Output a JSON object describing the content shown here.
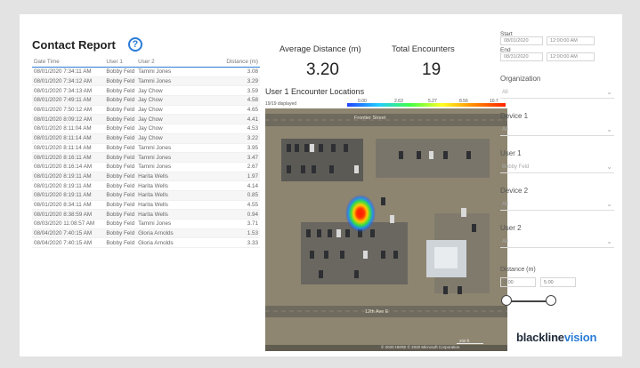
{
  "report": {
    "title": "Contact Report",
    "help_symbol": "?",
    "columns": [
      "Date Time",
      "User 1",
      "User 2",
      "Distance (m)"
    ],
    "rows": [
      [
        "08/01/2020 7:34:11 AM",
        "Bobby Feld",
        "Tammi Jones",
        "3.08"
      ],
      [
        "08/01/2020 7:34:12 AM",
        "Bobby Feld",
        "Tammi Jones",
        "3.29"
      ],
      [
        "08/01/2020 7:34:13 AM",
        "Bobby Feld",
        "Jay Chow",
        "3.59"
      ],
      [
        "08/01/2020 7:49:11 AM",
        "Bobby Feld",
        "Jay Chow",
        "4.58"
      ],
      [
        "08/01/2020 7:50:12 AM",
        "Bobby Feld",
        "Jay Chow",
        "4.65"
      ],
      [
        "08/01/2020 8:09:12 AM",
        "Bobby Feld",
        "Jay Chow",
        "4.41"
      ],
      [
        "08/01/2020 8:11:04 AM",
        "Bobby Feld",
        "Jay Chow",
        "4.53"
      ],
      [
        "08/01/2020 8:11:14 AM",
        "Bobby Feld",
        "Jay Chow",
        "3.22"
      ],
      [
        "08/01/2020 8:11:14 AM",
        "Bobby Feld",
        "Tammi Jones",
        "3.95"
      ],
      [
        "08/01/2020 8:16:11 AM",
        "Bobby Feld",
        "Tammi Jones",
        "3.47"
      ],
      [
        "08/01/2020 8:16:14 AM",
        "Bobby Feld",
        "Tammi Jones",
        "2.67"
      ],
      [
        "08/01/2020 8:19:11 AM",
        "Bobby Feld",
        "Harita Wells",
        "1.97"
      ],
      [
        "08/01/2020 8:19:11 AM",
        "Bobby Feld",
        "Harita Wells",
        "4.14"
      ],
      [
        "08/01/2020 8:19:11 AM",
        "Bobby Feld",
        "Harita Wells",
        "0.85"
      ],
      [
        "08/01/2020 8:34:11 AM",
        "Bobby Feld",
        "Harita Wells",
        "4.55"
      ],
      [
        "08/01/2020 8:38:59 AM",
        "Bobby Feld",
        "Harita Wells",
        "0.94"
      ],
      [
        "08/03/2020 11:08:57 AM",
        "Bobby Feld",
        "Tammi Jones",
        "3.71"
      ],
      [
        "08/04/2020 7:40:15 AM",
        "Bobby Feld",
        "Gloria Arnolds",
        "1.53"
      ],
      [
        "08/04/2020 7:40:15 AM",
        "Bobby Feld",
        "Gloria Arnolds",
        "3.33"
      ]
    ]
  },
  "kpis": {
    "avg_label": "Average Distance (m)",
    "avg_value": "3.20",
    "total_label": "Total Encounters",
    "total_value": "19"
  },
  "map": {
    "title": "User 1 Encounter Locations",
    "displayed": "19/19 displayed",
    "legend_ticks": [
      "0.00",
      "2.63",
      "5.27",
      "8.56",
      "10.7"
    ],
    "street_top": "Frontier Street",
    "street_bottom": "12th Ave E",
    "attribution": "© 2020 HERE © 2020 Microsoft Corporation",
    "scale_label": "200 ft"
  },
  "filters": {
    "start_label": "Start",
    "start_date": "08/01/2020",
    "start_time": "12:00:00 AM",
    "end_label": "End",
    "end_date": "08/31/2020",
    "end_time": "12:00:00 AM",
    "org_label": "Organization",
    "org_value": "All",
    "device1_label": "Device 1",
    "device1_value": "All",
    "user1_label": "User 1",
    "user1_value": "Bobby Feld",
    "device2_label": "Device 2",
    "device2_value": "All",
    "user2_label": "User 2",
    "user2_value": "All",
    "distance_label": "Distance (m)",
    "distance_min": "0.00",
    "distance_max": "5.00",
    "slider_range": [
      0.0,
      5.0
    ]
  },
  "brand": {
    "name_part1": "blackline",
    "name_part2": "vision",
    "accent_color": "#2b7bd6"
  }
}
